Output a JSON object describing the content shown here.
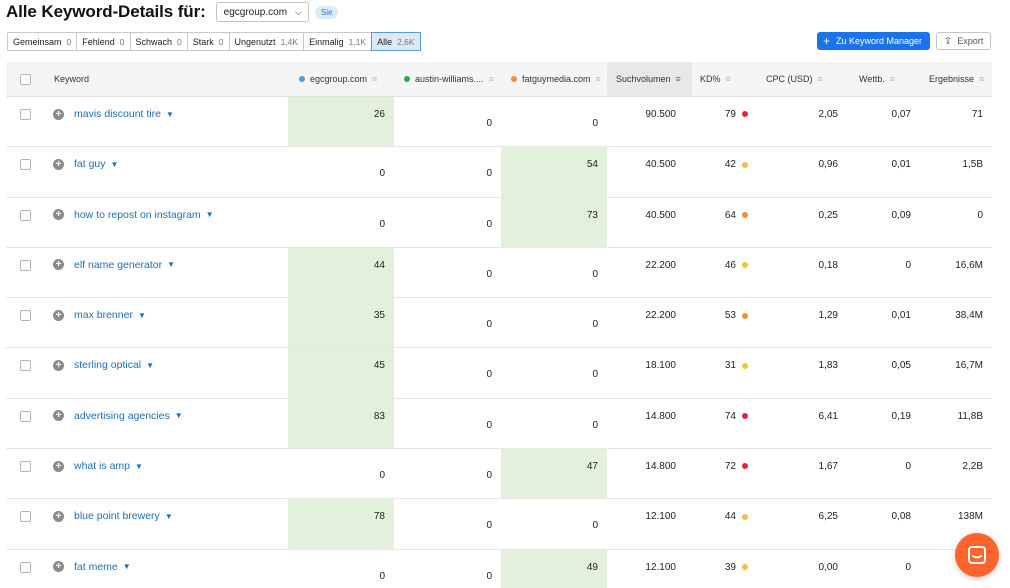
{
  "header": {
    "title": "Alle Keyword-Details für:",
    "domain_value": "egcgroup.com",
    "badge": "Sie"
  },
  "filters": [
    {
      "label": "Gemeinsam",
      "count": "0",
      "active": false
    },
    {
      "label": "Fehlend",
      "count": "0",
      "active": false
    },
    {
      "label": "Schwach",
      "count": "0",
      "active": false
    },
    {
      "label": "Stark",
      "count": "0",
      "active": false
    },
    {
      "label": "Ungenutzt",
      "count": "1,4K",
      "active": false
    },
    {
      "label": "Einmalig",
      "count": "1,1K",
      "active": false
    },
    {
      "label": "Alle",
      "count": "2,6K",
      "active": true
    }
  ],
  "actions": {
    "keyword_manager": "Zu Keyword Manager",
    "export": "Export"
  },
  "columns": {
    "keyword": "Keyword",
    "d1": "egcgroup.com",
    "d2": "austin-williams....",
    "d3": "fatguymedia.com",
    "volume": "Suchvolumen",
    "kd": "KD%",
    "cpc": "CPC (USD)",
    "comp": "Wettb.",
    "results": "Ergebnisse"
  },
  "colors": {
    "d1": "#4a9fe0",
    "d2": "#2fa84f",
    "d3": "#f0903a",
    "kd_red": "#e0263a",
    "kd_orange": "#f08a3c",
    "kd_yellow": "#f5c040",
    "highlight": "#e3f1dc",
    "accent": "#1a73e8"
  },
  "rows": [
    {
      "keyword": "mavis discount tire",
      "d1": "26",
      "d2": "0",
      "d3": "0",
      "top": "d1",
      "volume": "90.500",
      "kd": "79",
      "kd_color": "red",
      "cpc": "2,05",
      "comp": "0,07",
      "results": "71"
    },
    {
      "keyword": "fat guy",
      "d1": "0",
      "d2": "0",
      "d3": "54",
      "top": "d3",
      "volume": "40.500",
      "kd": "42",
      "kd_color": "yellow",
      "cpc": "0,96",
      "comp": "0,01",
      "results": "1,5B"
    },
    {
      "keyword": "how to repost on instagram",
      "d1": "0",
      "d2": "0",
      "d3": "73",
      "top": "d3",
      "volume": "40.500",
      "kd": "64",
      "kd_color": "orange",
      "cpc": "0,25",
      "comp": "0,09",
      "results": "0"
    },
    {
      "keyword": "elf name generator",
      "d1": "44",
      "d2": "0",
      "d3": "0",
      "top": "d1",
      "volume": "22.200",
      "kd": "46",
      "kd_color": "yellow",
      "cpc": "0,18",
      "comp": "0",
      "results": "16,6M"
    },
    {
      "keyword": "max brenner",
      "d1": "35",
      "d2": "0",
      "d3": "0",
      "top": "d1",
      "volume": "22.200",
      "kd": "53",
      "kd_color": "orange",
      "cpc": "1,29",
      "comp": "0,01",
      "results": "38,4M"
    },
    {
      "keyword": "sterling optical",
      "d1": "45",
      "d2": "0",
      "d3": "0",
      "top": "d1",
      "volume": "18.100",
      "kd": "31",
      "kd_color": "yellow",
      "cpc": "1,83",
      "comp": "0,05",
      "results": "16,7M"
    },
    {
      "keyword": "advertising agencies",
      "d1": "83",
      "d2": "0",
      "d3": "0",
      "top": "d1",
      "volume": "14.800",
      "kd": "74",
      "kd_color": "red",
      "cpc": "6,41",
      "comp": "0,19",
      "results": "11,8B"
    },
    {
      "keyword": "what is amp",
      "d1": "0",
      "d2": "0",
      "d3": "47",
      "top": "d3",
      "volume": "14.800",
      "kd": "72",
      "kd_color": "red",
      "cpc": "1,67",
      "comp": "0",
      "results": "2,2B"
    },
    {
      "keyword": "blue point brewery",
      "d1": "78",
      "d2": "0",
      "d3": "0",
      "top": "d1",
      "volume": "12.100",
      "kd": "44",
      "kd_color": "yellow",
      "cpc": "6,25",
      "comp": "0,08",
      "results": "138M"
    },
    {
      "keyword": "fat meme",
      "d1": "0",
      "d2": "0",
      "d3": "49",
      "top": "d3",
      "volume": "12.100",
      "kd": "39",
      "kd_color": "yellow",
      "cpc": "0,00",
      "comp": "0",
      "results": ""
    }
  ],
  "chat": {
    "icon": "chat-icon"
  }
}
